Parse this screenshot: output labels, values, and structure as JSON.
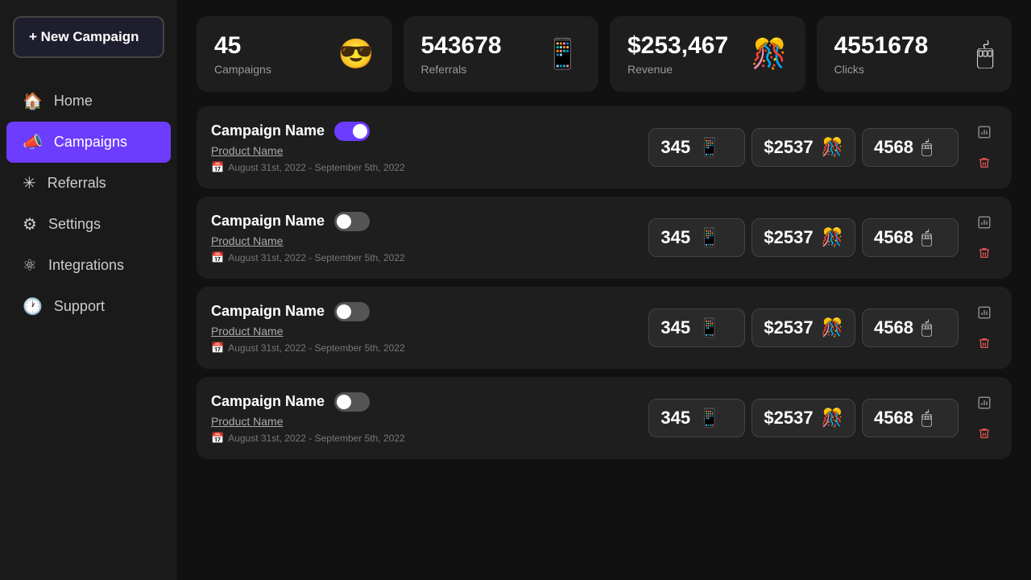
{
  "sidebar": {
    "new_campaign_label": "+ New Campaign",
    "nav_items": [
      {
        "id": "home",
        "label": "Home",
        "icon": "🏠",
        "active": false
      },
      {
        "id": "campaigns",
        "label": "Campaigns",
        "icon": "📣",
        "active": true
      },
      {
        "id": "referrals",
        "label": "Referrals",
        "icon": "✳",
        "active": false
      },
      {
        "id": "settings",
        "label": "Settings",
        "icon": "⚙",
        "active": false
      },
      {
        "id": "integrations",
        "label": "Integrations",
        "icon": "⚛",
        "active": false
      },
      {
        "id": "support",
        "label": "Support",
        "icon": "🕐",
        "active": false
      }
    ]
  },
  "stats": [
    {
      "value": "45",
      "label": "Campaigns",
      "emoji": "😎"
    },
    {
      "value": "543678",
      "label": "Referrals",
      "emoji": "📱"
    },
    {
      "value": "$253,467",
      "label": "Revenue",
      "emoji": "🎊"
    },
    {
      "value": "4551678",
      "label": "Clicks",
      "emoji": "🖱"
    }
  ],
  "campaigns": [
    {
      "name": "Campaign Name",
      "product": "Product Name",
      "date": "August 31st, 2022 - September 5th, 2022",
      "active": true,
      "referrals": "345",
      "referrals_emoji": "📱",
      "revenue": "$2537",
      "revenue_emoji": "🎊",
      "clicks": "4568",
      "clicks_emoji": "🖱"
    },
    {
      "name": "Campaign Name",
      "product": "Product Name",
      "date": "August 31st, 2022 - September 5th, 2022",
      "active": false,
      "referrals": "345",
      "referrals_emoji": "📱",
      "revenue": "$2537",
      "revenue_emoji": "🎊",
      "clicks": "4568",
      "clicks_emoji": "🖱"
    },
    {
      "name": "Campaign Name",
      "product": "Product Name",
      "date": "August 31st, 2022 - September 5th, 2022",
      "active": false,
      "referrals": "345",
      "referrals_emoji": "📱",
      "revenue": "$2537",
      "revenue_emoji": "🎊",
      "clicks": "4568",
      "clicks_emoji": "🖱"
    },
    {
      "name": "Campaign Name",
      "product": "Product Name",
      "date": "August 31st, 2022 - September 5th, 2022",
      "active": false,
      "referrals": "345",
      "referrals_emoji": "📱",
      "revenue": "$2537",
      "revenue_emoji": "🎊",
      "clicks": "4568",
      "clicks_emoji": "🖱"
    }
  ]
}
